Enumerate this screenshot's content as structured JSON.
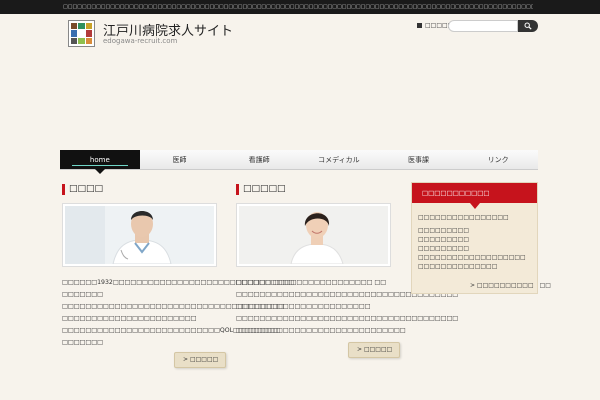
{
  "topbar": {
    "text": "□□□□□□□□□□□□□□□□□□□□□□□□□□□□□□□□□□□□□□□□□□□□□□□□□□□□□□□□□□□□□□□□□□□□□□□□□□□□□□□□□□□□□□□□□□□□□□□□□□□□□□□□□□□□□□□□□□□□□□□□□□□□□□□□□□□□□□□"
  },
  "header": {
    "title": "江戸川病院求人サイト",
    "url": "edogawa-recruit.com",
    "contact_label": "□□□□□",
    "search_placeholder": ""
  },
  "nav": {
    "items": [
      {
        "label": "home"
      },
      {
        "label": "医師"
      },
      {
        "label": "看護師"
      },
      {
        "label": "コメディカル"
      },
      {
        "label": "医事課"
      },
      {
        "label": "リンク"
      }
    ]
  },
  "col1": {
    "title": "□□□□",
    "line1": "□□□□□□1932□□□□□□□□□□□□□□□□□□□□□□□□□□□□□□□",
    "line2": "□□□□□□□",
    "line3": "□□□□□□□□□□□□□□□□□□□□□□□□□□□□□□□□□□□□□□",
    "line4": "□□□□□□□□□□□□□□□□□□□□□□□",
    "line5": "□□□□□□□□□□□□□□□□□□□□□□□□□□□QOL□□□□□□□□",
    "line6": "□□□□□□□",
    "more": "□□□□□"
  },
  "col2": {
    "title": "□□□□□",
    "line1": "□□□□□□ □□□□□□□□□□□□□□□□□ □□",
    "line2": "□□□□□□□□□□□□□□□□□□□□□□□□□□□□□□□□□□□□□□",
    "line3": "□□□□□□□□□□□□□□□□□□□□□□□",
    "line4": "□□□□□□□□□□□□□□□□□□□□□□□□□□□□□□□□□□□□□□",
    "line5": "□□□□□□□□□□□□□□□□□□□□□□□□□□□□□",
    "more": "□□□□□"
  },
  "sidebar": {
    "title": "□□□□□□□□□□□",
    "line1": "□□□□□□□□□□□□□□□□",
    "link1": "□□□□□□□□□",
    "link2": "□□□□□□□□□",
    "link3": "□□□□□□□□□",
    "link4": "□□□□□□□□□□□□□□□□□□□",
    "link5": "□□□□□□□□□□□□□□",
    "more": "> □□□□□□□□□□　□□"
  }
}
